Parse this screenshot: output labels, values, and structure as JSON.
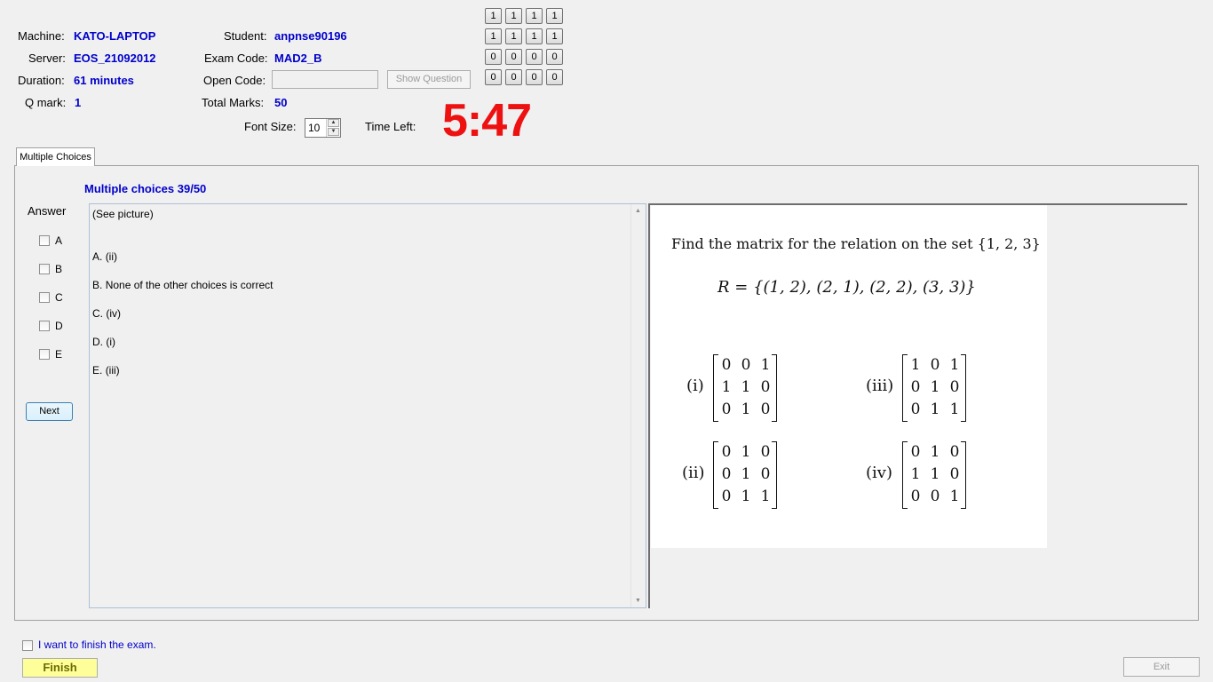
{
  "header": {
    "machine_label": "Machine:",
    "machine": "KATO-LAPTOP",
    "server_label": "Server:",
    "server": "EOS_21092012",
    "duration_label": "Duration:",
    "duration": "61 minutes",
    "qmark_label": "Q mark:",
    "qmark": "1",
    "student_label": "Student:",
    "student": "anpnse90196",
    "exam_code_label": "Exam Code:",
    "exam_code": "MAD2_B",
    "open_code_label": "Open Code:",
    "open_code_value": "",
    "show_question_label": "Show Question",
    "total_marks_label": "Total Marks:",
    "total_marks": "50",
    "font_size_label": "Font Size:",
    "font_size": "10",
    "time_left_label": "Time Left:",
    "time_left": "5:47"
  },
  "code_grid": [
    [
      "1",
      "1",
      "1",
      "1"
    ],
    [
      "1",
      "1",
      "1",
      "1"
    ],
    [
      "0",
      "0",
      "0",
      "0"
    ],
    [
      "0",
      "0",
      "0",
      "0"
    ]
  ],
  "tab": {
    "label": "Multiple Choices"
  },
  "question": {
    "title": "Multiple choices 39/50",
    "answer_label": "Answer",
    "answer_options": [
      "A",
      "B",
      "C",
      "D",
      "E"
    ],
    "next_label": "Next",
    "prompt": "(See picture)",
    "choices": [
      {
        "letter": "A.",
        "text": "(ii)"
      },
      {
        "letter": "B.",
        "text": "None of the other choices is correct"
      },
      {
        "letter": "C.",
        "text": "(iv)"
      },
      {
        "letter": "D.",
        "text": "(i)"
      },
      {
        "letter": "E.",
        "text": "(iii)"
      }
    ]
  },
  "picture": {
    "statement": "Find the matrix  for the relation on the set {1, 2, 3}",
    "relation": "R = {(1, 2), (2, 1), (2, 2), (3, 3)}",
    "matrices": [
      {
        "label": "(i)",
        "rows": [
          [
            "0",
            "0",
            "1"
          ],
          [
            "1",
            "1",
            "0"
          ],
          [
            "0",
            "1",
            "0"
          ]
        ]
      },
      {
        "label": "(iii)",
        "rows": [
          [
            "1",
            "0",
            "1"
          ],
          [
            "0",
            "1",
            "0"
          ],
          [
            "0",
            "1",
            "1"
          ]
        ]
      },
      {
        "label": "(ii)",
        "rows": [
          [
            "0",
            "1",
            "0"
          ],
          [
            "0",
            "1",
            "0"
          ],
          [
            "0",
            "1",
            "1"
          ]
        ]
      },
      {
        "label": "(iv)",
        "rows": [
          [
            "0",
            "1",
            "0"
          ],
          [
            "1",
            "1",
            "0"
          ],
          [
            "0",
            "0",
            "1"
          ]
        ]
      }
    ]
  },
  "footer": {
    "finish_checkbox_label": "I want to finish the exam.",
    "finish_label": "Finish",
    "exit_label": "Exit"
  },
  "colors": {
    "value_blue": "#0000cc",
    "timer_red": "#ee1111",
    "finish_yellow": "#ffff99"
  }
}
